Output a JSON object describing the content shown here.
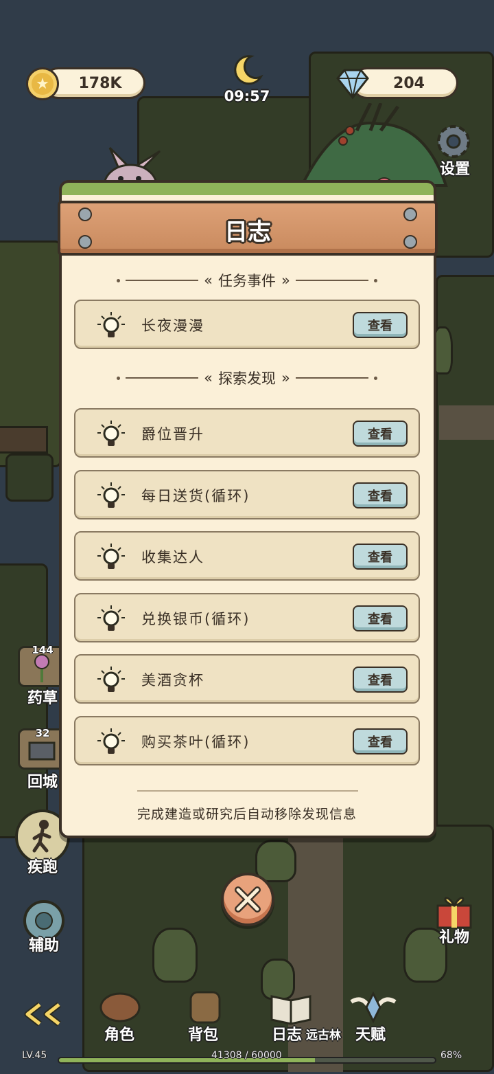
{
  "hud": {
    "coins": "178K",
    "gems": "204",
    "time": "09:57",
    "settings_label": "设置",
    "gift_label": "礼物"
  },
  "side": {
    "herb_count": "144",
    "herb_label": "药草",
    "return_count": "32",
    "return_label": "回城",
    "run_label": "疾跑",
    "assist_label": "辅助"
  },
  "journal": {
    "title": "日志",
    "section_tasks": "任务事件",
    "section_discover": "探索发现",
    "view_label": "查看",
    "tasks": [
      "长夜漫漫"
    ],
    "discoveries": [
      "爵位晋升",
      "每日送货(循环)",
      "收集达人",
      "兑换银币(循环)",
      "美酒贪杯",
      "购买茶叶(循环)"
    ],
    "footer": "完成建造或研究后自动移除发现信息"
  },
  "bottom": {
    "role_label": "角色",
    "bag_label": "背包",
    "log_label": "日志",
    "log_suffix": "远古林",
    "talent_label": "天赋",
    "level": "LV.45",
    "xp": "41308 / 60000",
    "percent": "68%",
    "progress": 0.68
  },
  "colors": {
    "accent_button": "#bfdadc",
    "modal_bg": "#fbf0d8",
    "plank": "#c98a5e",
    "xp_fill": "#8fb35a"
  }
}
